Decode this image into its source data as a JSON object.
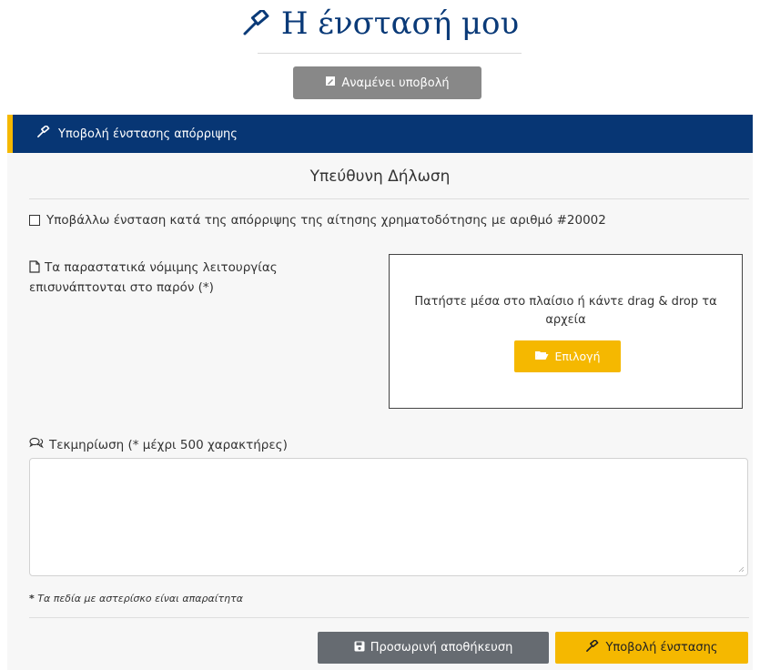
{
  "header": {
    "title": "Η ένστασή μου",
    "title_icon": "gavel-icon",
    "status_badge": "Αναμένει υποβολή",
    "status_icon": "file-edit-icon"
  },
  "panel": {
    "title": "Υποβολή ένστασης απόρριψης",
    "title_icon": "gavel-icon",
    "declaration_title": "Υπεύθυνη Δήλωση",
    "declaration_checkbox_label": "Υποβάλλω ένσταση κατά της απόρριψης της αίτησης χρηματοδότησης με αριθμό #20002",
    "declaration_checked": false,
    "documents_label": "Τα παραστατικά νόμιμης λειτουργίας επισυνάπτονται στο παρόν (*)",
    "dropzone_hint": "Πατήστε μέσα στο πλαίσιο ή κάντε drag & drop τα αρχεία",
    "choose_button": "Επιλογή",
    "justification_label": "Τεκμηρίωση (* μέχρι 500 χαρακτήρες)",
    "justification_value": "",
    "required_note_star": "*",
    "required_note": "Τα πεδία με αστερίσκο είναι απαραίτητα",
    "save_button": "Προσωρινή αποθήκευση",
    "submit_button": "Υποβολή ένστασης"
  },
  "colors": {
    "navy": "#073674",
    "accent_yellow": "#f5b800",
    "badge_gray": "#888888",
    "save_gray": "#666b71"
  }
}
